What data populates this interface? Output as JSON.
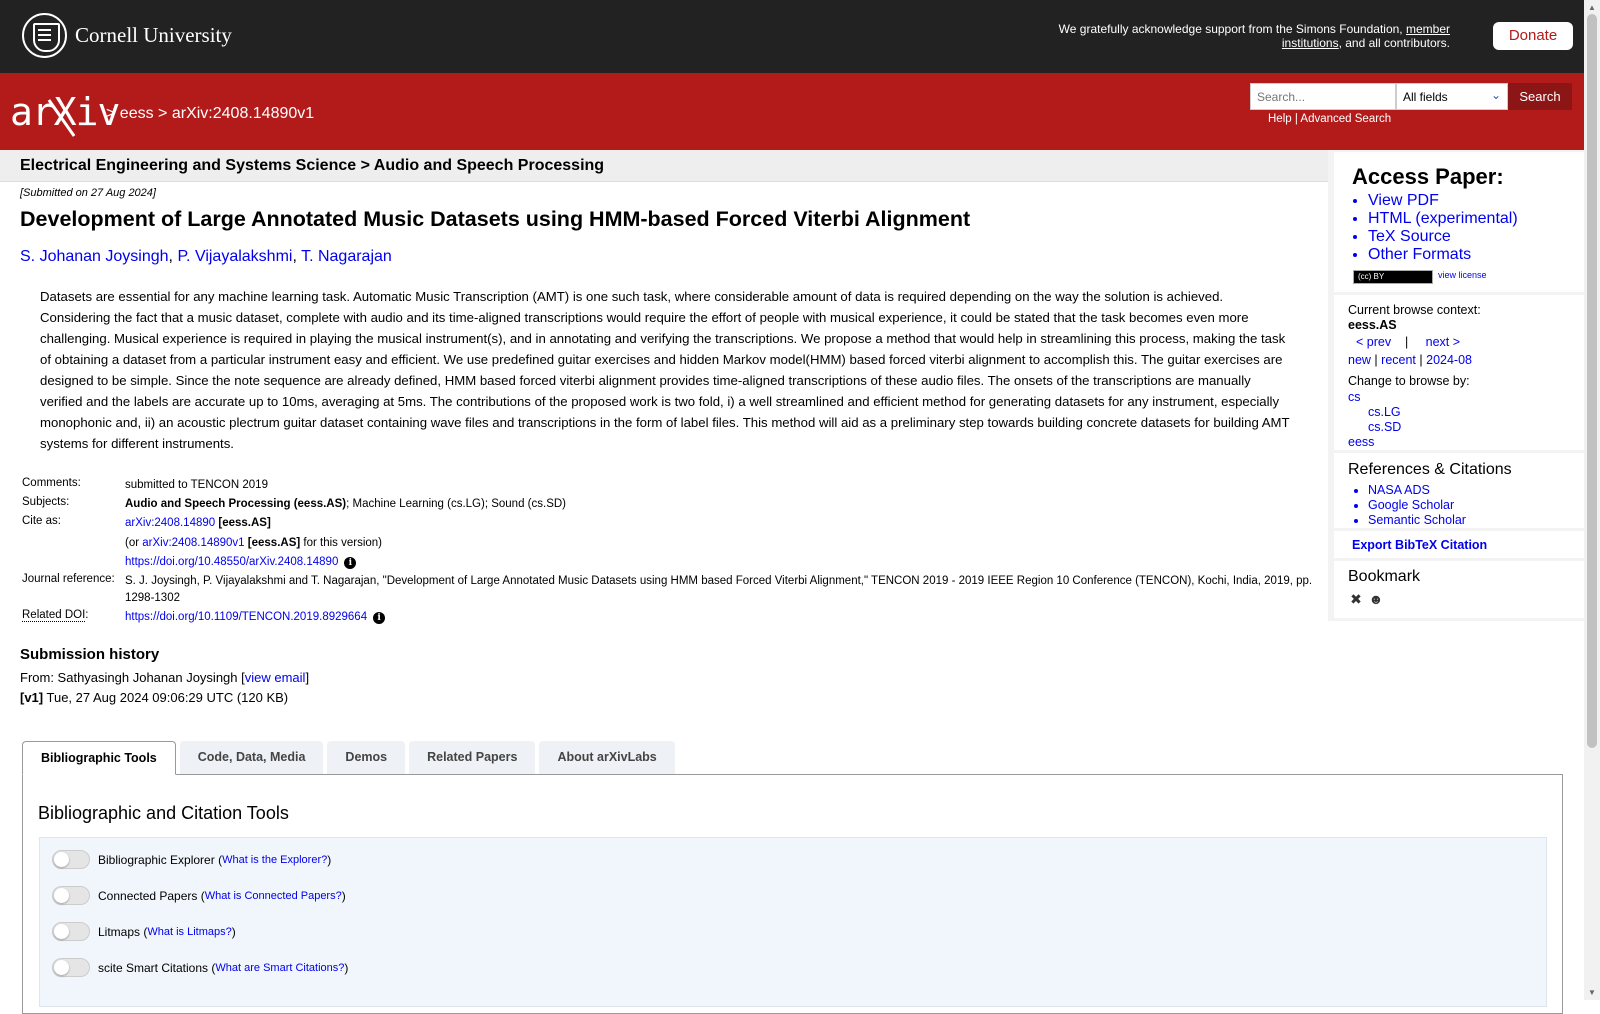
{
  "topbar": {
    "university": "Cornell University",
    "ack_prefix": "We gratefully acknowledge support from the Simons Foundation,",
    "ack_link": "member institutions",
    "ack_suffix": ", and all contributors.",
    "donate": "Donate"
  },
  "header": {
    "logo": "arXiv",
    "crumb_sep1": ">",
    "crumb_category": "eess",
    "crumb_sep2": ">",
    "crumb_id": "arXiv:2408.14890v1",
    "search_placeholder": "Search...",
    "search_field": "All fields",
    "search_button": "Search",
    "help": "Help",
    "help_sep": "|",
    "advanced": "Advanced Search"
  },
  "main": {
    "subheader": "Electrical Engineering and Systems Science > Audio and Speech Processing",
    "submitted": "[Submitted on 27 Aug 2024]",
    "title": "Development of Large Annotated Music Datasets using HMM-based Forced Viterbi Alignment",
    "authors": [
      "S. Johanan Joysingh",
      "P. Vijayalakshmi",
      "T. Nagarajan"
    ],
    "abstract": "Datasets are essential for any machine learning task. Automatic Music Transcription (AMT) is one such task, where considerable amount of data is required depending on the way the solution is achieved. Considering the fact that a music dataset, complete with audio and its time-aligned transcriptions would require the effort of people with musical experience, it could be stated that the task becomes even more challenging. Musical experience is required in playing the musical instrument(s), and in annotating and verifying the transcriptions. We propose a method that would help in streamlining this process, making the task of obtaining a dataset from a particular instrument easy and efficient. We use predefined guitar exercises and hidden Markov model(HMM) based forced viterbi alignment to accomplish this. The guitar exercises are designed to be simple. Since the note sequence are already defined, HMM based forced viterbi alignment provides time-aligned transcriptions of these audio files. The onsets of the transcriptions are manually verified and the labels are accurate up to 10ms, averaging at 5ms. The contributions of the proposed work is two fold, i) a well streamlined and efficient method for generating datasets for any instrument, especially monophonic and, ii) an acoustic plectrum guitar dataset containing wave files and transcriptions in the form of label files. This method will aid as a preliminary step towards building concrete datasets for building AMT systems for different instruments."
  },
  "meta": {
    "comments_label": "Comments:",
    "comments": "submitted to TENCON 2019",
    "subjects_label": "Subjects:",
    "subjects_primary": "Audio and Speech Processing (eess.AS)",
    "subjects_rest": "; Machine Learning (cs.LG); Sound (cs.SD)",
    "cite_label": "Cite as:",
    "cite_id": "arXiv:2408.14890",
    "cite_cat": "[eess.AS]",
    "cite_or": "(or",
    "cite_version": "arXiv:2408.14890v1",
    "cite_version_cat": "[eess.AS]",
    "cite_version_suffix": "for this version)",
    "doi_link": "https://doi.org/10.48550/arXiv.2408.14890",
    "journal_label": "Journal reference:",
    "journal": "S. J. Joysingh, P. Vijayalakshmi and T. Nagarajan, \"Development of Large Annotated Music Datasets using HMM based Forced Viterbi Alignment,\" TENCON 2019 - 2019 IEEE Region 10 Conference (TENCON), Kochi, India, 2019, pp. 1298-1302",
    "related_doi_label": "Related DOI",
    "related_doi_colon": ":",
    "related_doi": "https://doi.org/10.1109/TENCON.2019.8929664"
  },
  "history": {
    "title": "Submission history",
    "from_prefix": "From: Sathyasingh Johanan Joysingh [",
    "view_email": "view email",
    "from_suffix": "]",
    "v1_label": "[v1]",
    "v1_text": "Tue, 27 Aug 2024 09:06:29 UTC (120 KB)"
  },
  "tabs": [
    "Bibliographic Tools",
    "Code, Data, Media",
    "Demos",
    "Related Papers",
    "About arXivLabs"
  ],
  "panel": {
    "title": "Bibliographic and Citation Tools",
    "tools": [
      {
        "label": "Bibliographic Explorer",
        "link": "What is the Explorer?"
      },
      {
        "label": "Connected Papers",
        "link": "What is Connected Papers?"
      },
      {
        "label": "Litmaps",
        "link": "What is Litmaps?"
      },
      {
        "label": "scite Smart Citations",
        "link": "What are Smart Citations?"
      }
    ]
  },
  "sidebar": {
    "access_title": "Access Paper:",
    "access_links": [
      "View PDF",
      "HTML (experimental)",
      "TeX Source",
      "Other Formats"
    ],
    "license_badge": "(cc) BY",
    "view_license": "view license",
    "context_label": "Current browse context:",
    "context_value": "eess.AS",
    "prev": "< prev",
    "nav_sep": "|",
    "next": "next >",
    "new": "new",
    "recent": "recent",
    "month": "2024-08",
    "sub_sep": "|",
    "change_label": "Change to browse by:",
    "categories": [
      "cs",
      "cs.LG",
      "cs.SD",
      "eess"
    ],
    "refs_title": "References & Citations",
    "refs": [
      "NASA ADS",
      "Google Scholar",
      "Semantic Scholar"
    ],
    "bibtex": "Export BibTeX Citation",
    "bookmark_title": "Bookmark"
  },
  "colors": {
    "arxiv_red": "#b31b1b",
    "topbar": "#222222",
    "link": "#0000ee"
  }
}
